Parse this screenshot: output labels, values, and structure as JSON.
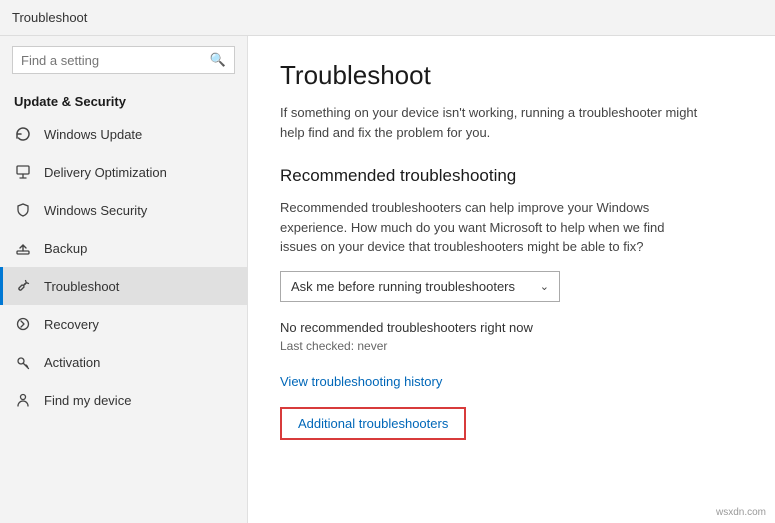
{
  "titleBar": {
    "text": "Troubleshoot"
  },
  "sidebar": {
    "searchPlaceholder": "Find a setting",
    "sectionLabel": "Update & Security",
    "items": [
      {
        "id": "windows-update",
        "label": "Windows Update",
        "icon": "refresh"
      },
      {
        "id": "delivery-optimization",
        "label": "Delivery Optimization",
        "icon": "download"
      },
      {
        "id": "windows-security",
        "label": "Windows Security",
        "icon": "shield"
      },
      {
        "id": "backup",
        "label": "Backup",
        "icon": "upload"
      },
      {
        "id": "troubleshoot",
        "label": "Troubleshoot",
        "icon": "wrench",
        "active": true
      },
      {
        "id": "recovery",
        "label": "Recovery",
        "icon": "refresh-circle"
      },
      {
        "id": "activation",
        "label": "Activation",
        "icon": "key"
      },
      {
        "id": "find-my-device",
        "label": "Find my device",
        "icon": "person"
      }
    ]
  },
  "content": {
    "pageTitle": "Troubleshoot",
    "pageSubtitle": "If something on your device isn't working, running a troubleshooter might help find and fix the problem for you.",
    "recommendedTitle": "Recommended troubleshooting",
    "recommendedDesc": "Recommended troubleshooters can help improve your Windows experience. How much do you want Microsoft to help when we find issues on your device that troubleshooters might be able to fix?",
    "dropdownValue": "Ask me before running troubleshooters",
    "statusText": "No recommended troubleshooters right now",
    "lastChecked": "Last checked: never",
    "viewHistoryLink": "View troubleshooting history",
    "additionalBtn": "Additional troubleshooters"
  },
  "watermark": "wsxdn.com"
}
